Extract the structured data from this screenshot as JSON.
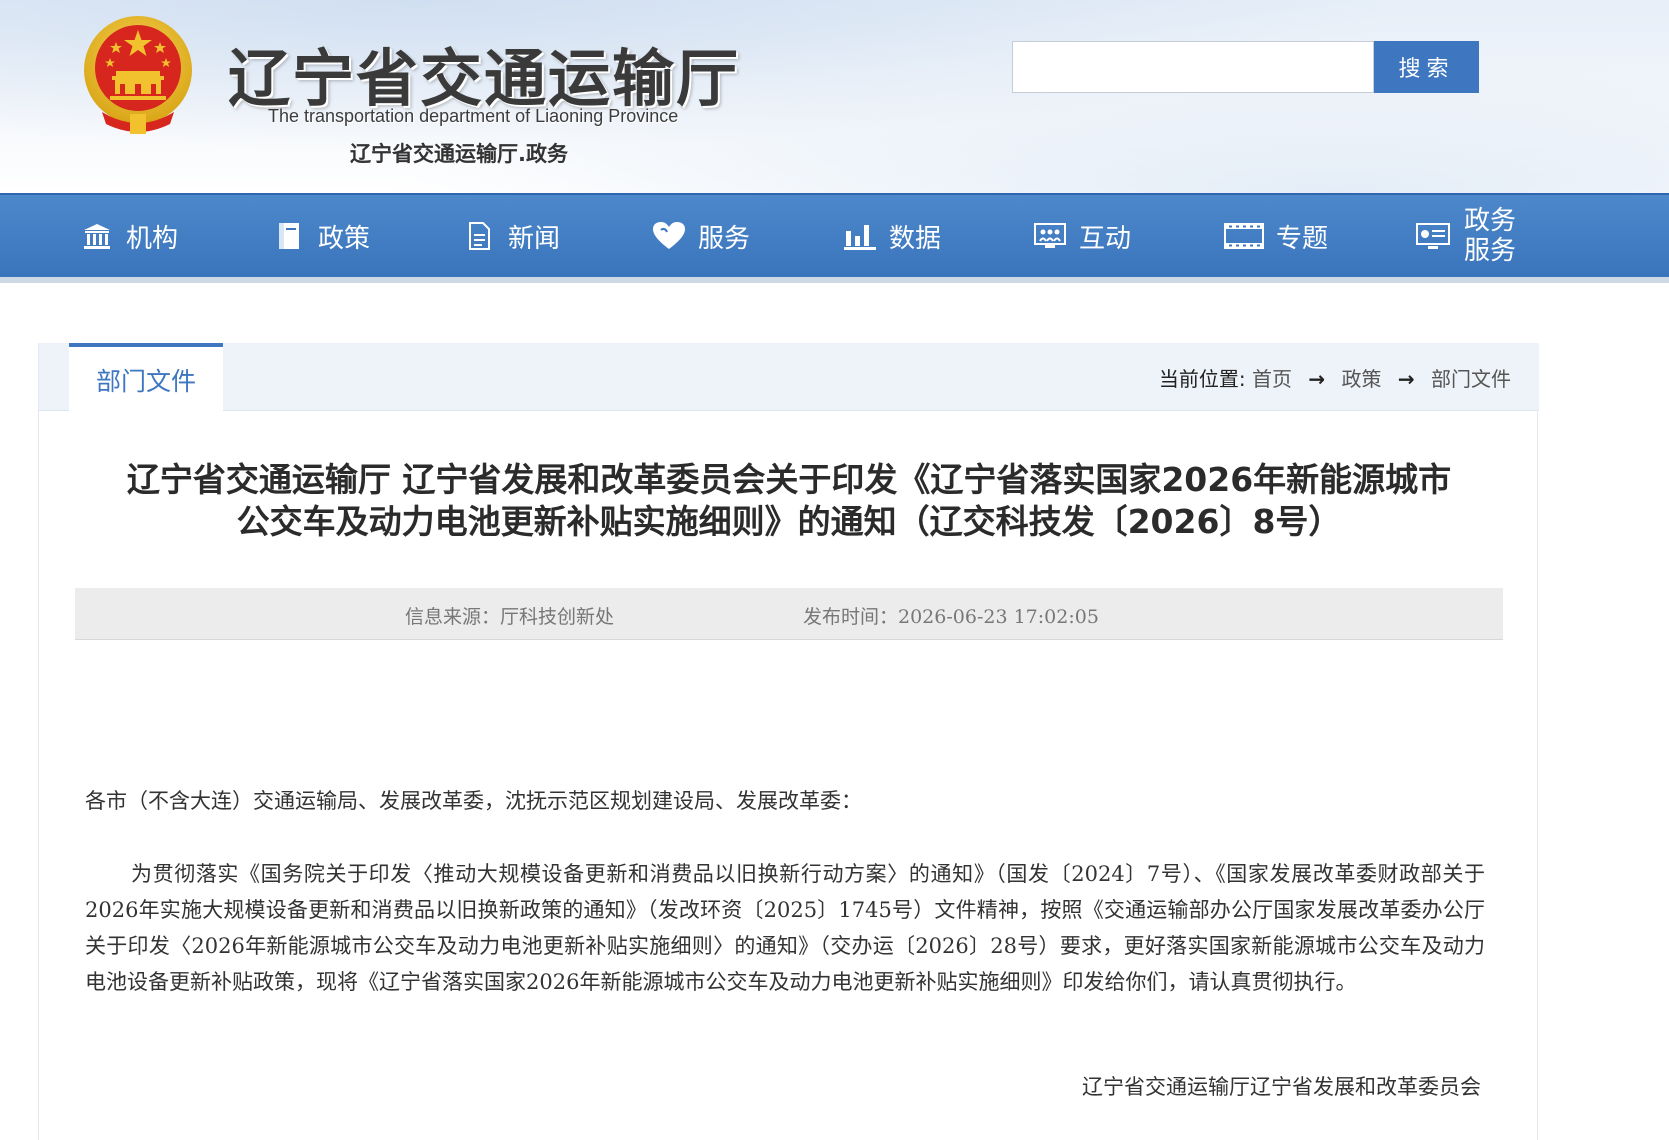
{
  "header": {
    "title": "辽宁省交通运输厅",
    "subtitle_en": "The transportation department of Liaoning Province",
    "subtitle_cn": "辽宁省交通运输厅.政务",
    "emblem_icon": "national-emblem-icon"
  },
  "search": {
    "placeholder": "",
    "value": "",
    "button_label": "搜索"
  },
  "nav": {
    "items": [
      {
        "label": "机构",
        "icon": "institution-icon"
      },
      {
        "label": "政策",
        "icon": "document-icon"
      },
      {
        "label": "新闻",
        "icon": "news-icon"
      },
      {
        "label": "服务",
        "icon": "heart-icon"
      },
      {
        "label": "数据",
        "icon": "bar-chart-icon"
      },
      {
        "label": "互动",
        "icon": "interaction-icon"
      },
      {
        "label": "专题",
        "icon": "film-icon"
      },
      {
        "label_line1": "政务",
        "label_line2": "服务",
        "icon": "gov-service-icon"
      }
    ]
  },
  "section": {
    "tab_label": "部门文件"
  },
  "breadcrumb": {
    "label": "当前位置:",
    "items": [
      "首页",
      "政策",
      "部门文件"
    ],
    "separator": "→"
  },
  "article": {
    "title_line1": "辽宁省交通运输厅 辽宁省发展和改革委员会关于印发《辽宁省落实国家2026年新能源城市",
    "title_line2": "公交车及动力电池更新补贴实施细则》的通知（辽交科技发〔2026〕8号）",
    "source": "信息来源：厅科技创新处",
    "publish_time": "发布时间：2026-06-23 17:02:05",
    "salutation": "各市（不含大连）交通运输局、发展改革委，沈抚示范区规划建设局、发展改革委：",
    "paragraph": "为贯彻落实《国务院关于印发〈推动大规模设备更新和消费品以旧换新行动方案〉的通知》（国发〔2024〕7号）、《国家发展改革委财政部关于2026年实施大规模设备更新和消费品以旧换新政策的通知》（发改环资〔2025〕1745号）文件精神，按照《交通运输部办公厅国家发展改革委办公厅关于印发〈2026年新能源城市公交车及动力电池更新补贴实施细则〉的通知》（交办运〔2026〕28号）要求，更好落实国家新能源城市公交车及动力电池设备更新补贴政策，现将《辽宁省落实国家2026年新能源城市公交车及动力电池更新补贴实施细则》印发给你们，请认真贯彻执行。",
    "signature": "辽宁省交通运输厅辽宁省发展和改革委员会"
  },
  "colors": {
    "nav_blue": "#3e77c0",
    "emblem_red": "#d7261e",
    "emblem_gold": "#f2c22e"
  }
}
